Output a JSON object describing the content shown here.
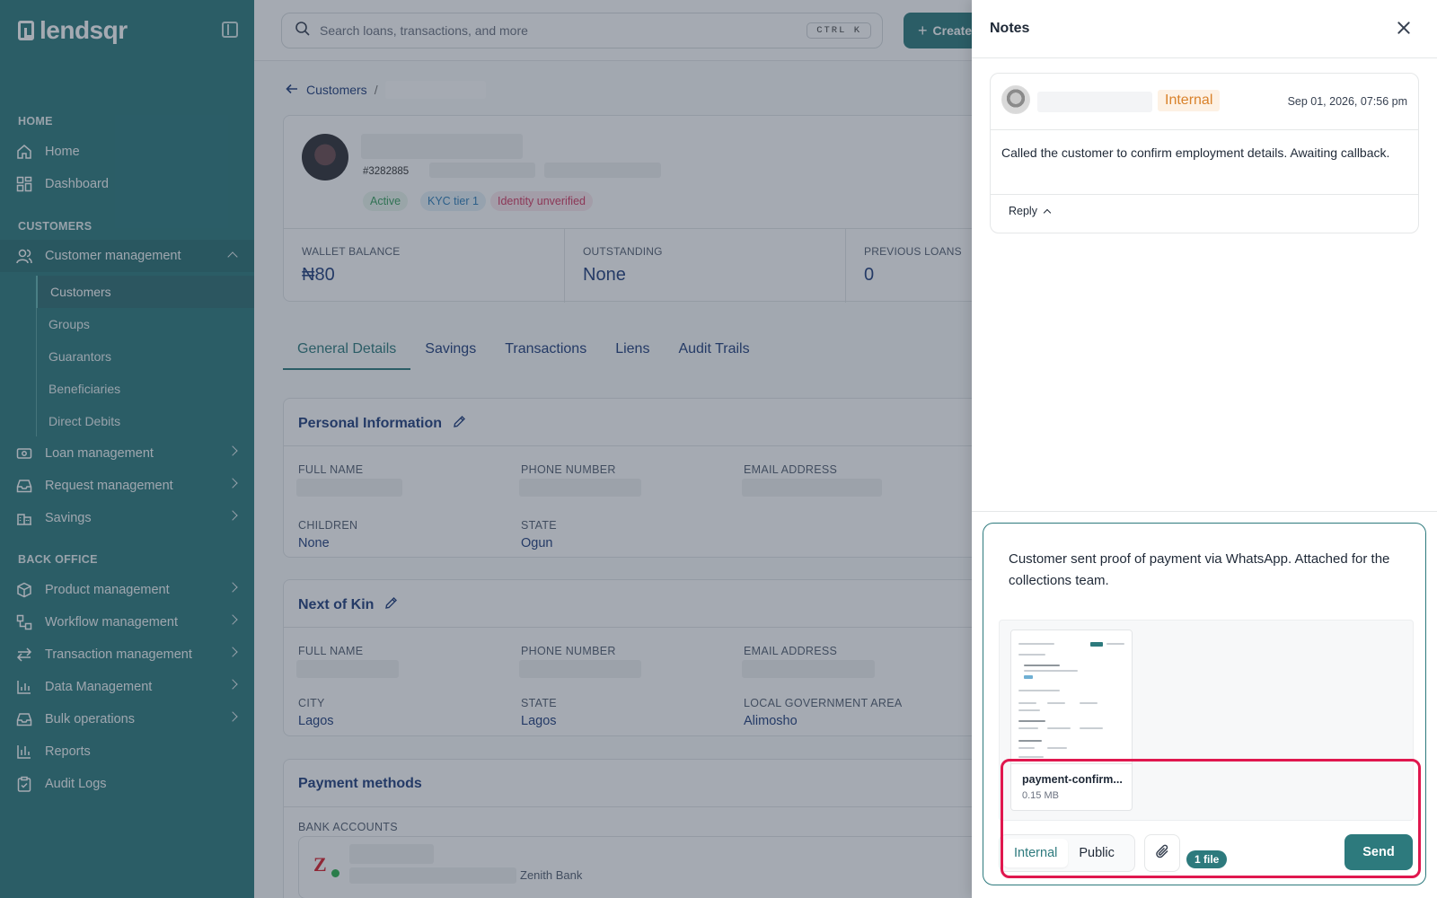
{
  "app": {
    "brand": "lendsqr"
  },
  "sidebar": {
    "sections": {
      "home": "HOME",
      "customers": "CUSTOMERS",
      "back_office": "BACK OFFICE"
    },
    "home_items": [
      {
        "label": "Home",
        "icon": "home-icon"
      },
      {
        "label": "Dashboard",
        "icon": "dashboard-icon"
      }
    ],
    "customer_management": {
      "label": "Customer management",
      "icon": "users-icon",
      "expanded": true
    },
    "customer_sub": [
      "Customers",
      "Groups",
      "Guarantors",
      "Beneficiaries",
      "Direct Debits"
    ],
    "customer_more": [
      {
        "label": "Loan management",
        "icon": "loan-icon"
      },
      {
        "label": "Request management",
        "icon": "inbox-icon"
      },
      {
        "label": "Savings",
        "icon": "bank-icon"
      }
    ],
    "back_office_items": [
      {
        "label": "Product management",
        "icon": "box-icon",
        "chevron": true
      },
      {
        "label": "Workflow management",
        "icon": "workflow-icon",
        "chevron": true
      },
      {
        "label": "Transaction management",
        "icon": "transfer-icon",
        "chevron": true
      },
      {
        "label": "Data Management",
        "icon": "chart-icon",
        "chevron": true
      },
      {
        "label": "Bulk operations",
        "icon": "inbox-icon",
        "chevron": true
      },
      {
        "label": "Reports",
        "icon": "bar-chart-icon",
        "chevron": false
      },
      {
        "label": "Audit Logs",
        "icon": "clipboard-icon",
        "chevron": false
      }
    ]
  },
  "topbar": {
    "search_placeholder": "Search loans, transactions, and more",
    "shortcut": "CTRL K",
    "create_label": "Create"
  },
  "breadcrumb": {
    "parent": "Customers",
    "separator": "/"
  },
  "customer": {
    "id": "#3282885",
    "badges": [
      "Active",
      "KYC tier 1",
      "Identity unverified"
    ],
    "stats": [
      {
        "label": "WALLET BALANCE",
        "value": "₦80"
      },
      {
        "label": "OUTSTANDING",
        "value": "None"
      },
      {
        "label": "PREVIOUS LOANS",
        "value": "0"
      }
    ]
  },
  "tabs": [
    "General Details",
    "Savings",
    "Transactions",
    "Liens",
    "Audit Trails"
  ],
  "personal_info": {
    "title": "Personal Information",
    "labels": {
      "full_name": "FULL NAME",
      "phone": "PHONE NUMBER",
      "email": "EMAIL ADDRESS",
      "children": "CHILDREN",
      "state": "STATE"
    },
    "children": "None",
    "state": "Ogun"
  },
  "next_of_kin": {
    "title": "Next of Kin",
    "labels": {
      "full_name": "FULL NAME",
      "phone": "PHONE NUMBER",
      "email": "EMAIL ADDRESS",
      "city": "CITY",
      "state": "STATE",
      "lga": "LOCAL GOVERNMENT AREA"
    },
    "city": "Lagos",
    "state": "Lagos",
    "lga": "Alimosho"
  },
  "payment_methods": {
    "title": "Payment methods",
    "bank_accounts_label": "BANK ACCOUNTS",
    "bank_name": "Zenith Bank"
  },
  "notes": {
    "title": "Notes",
    "note": {
      "visibility": "Internal",
      "date": "Sep 01, 2026, 07:56 pm",
      "body": "Called the customer to confirm employment details. Awaiting callback.",
      "reply_label": "Reply"
    },
    "composer": {
      "text": "Customer sent proof of payment via WhatsApp. Attached for the collections team.",
      "attachment": {
        "name": "payment-confirm...",
        "size": "0.15 MB"
      },
      "visibility_options": [
        "Internal",
        "Public"
      ],
      "selected_visibility": "Internal",
      "file_count": "1 file",
      "send_label": "Send"
    }
  },
  "colors": {
    "brand": "#2d7a7d",
    "highlight": "#e0174e",
    "internal_badge": "#d9822b"
  }
}
